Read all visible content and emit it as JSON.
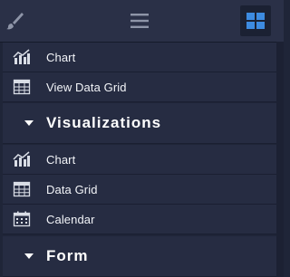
{
  "toolbar": {
    "brush_icon": "paintbrush-icon",
    "menu_icon": "hamburger-menu-icon",
    "grid_icon": "grid-view-icon",
    "accent_color": "#3d8be0"
  },
  "top_items": [
    {
      "label": "Chart",
      "icon": "chart-icon"
    },
    {
      "label": "View Data Grid",
      "icon": "data-grid-icon"
    }
  ],
  "sections": [
    {
      "title": "Visualizations",
      "expanded": true,
      "items": [
        {
          "label": "Chart",
          "icon": "chart-icon"
        },
        {
          "label": "Data Grid",
          "icon": "data-grid-icon"
        },
        {
          "label": "Calendar",
          "icon": "calendar-icon"
        }
      ]
    },
    {
      "title": "Form",
      "expanded": true,
      "items": []
    }
  ]
}
